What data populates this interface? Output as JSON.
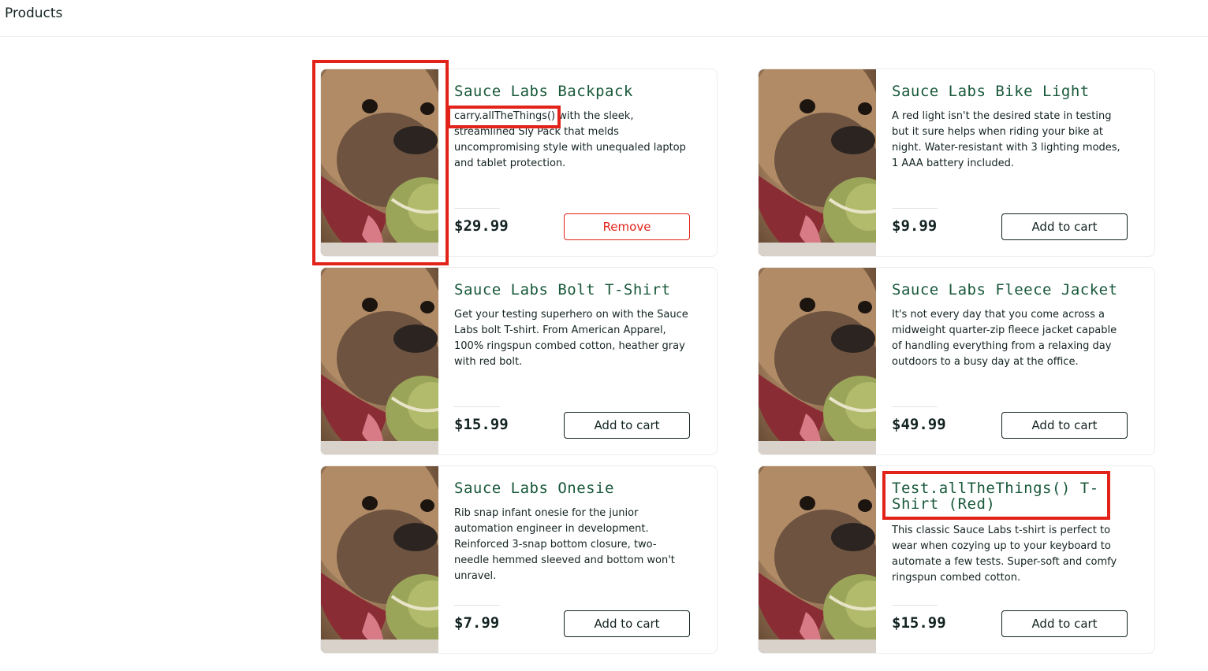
{
  "header": {
    "title": "Products"
  },
  "products": [
    {
      "name": "Sauce Labs Backpack",
      "description": "carry.allTheThings() with the sleek, streamlined Sly Pack that melds uncompromising style with unequaled laptop and tablet protection.",
      "price": "$29.99",
      "button": "Remove"
    },
    {
      "name": "Sauce Labs Bike Light",
      "description": "A red light isn't the desired state in testing but it sure helps when riding your bike at night. Water-resistant with 3 lighting modes, 1 AAA battery included.",
      "price": "$9.99",
      "button": "Add to cart"
    },
    {
      "name": "Sauce Labs Bolt T-Shirt",
      "description": "Get your testing superhero on with the Sauce Labs bolt T-shirt. From American Apparel, 100% ringspun combed cotton, heather gray with red bolt.",
      "price": "$15.99",
      "button": "Add to cart"
    },
    {
      "name": "Sauce Labs Fleece Jacket",
      "description": "It's not every day that you come across a midweight quarter-zip fleece jacket capable of handling everything from a relaxing day outdoors to a busy day at the office.",
      "price": "$49.99",
      "button": "Add to cart"
    },
    {
      "name": "Sauce Labs Onesie",
      "description": "Rib snap infant onesie for the junior automation engineer in development. Reinforced 3-snap bottom closure, two-needle hemmed sleeved and bottom won't unravel.",
      "price": "$7.99",
      "button": "Add to cart"
    },
    {
      "name": "Test.allTheThings() T-Shirt (Red)",
      "description": "This classic Sauce Labs t-shirt is perfect to wear when cozying up to your keyboard to automate a few tests. Super-soft and comfy ringspun combed cotton.",
      "price": "$15.99",
      "button": "Add to cart"
    }
  ],
  "colors": {
    "product_name": "#18583a",
    "remove_button": "#e2231a",
    "highlight": "#e2231a"
  }
}
